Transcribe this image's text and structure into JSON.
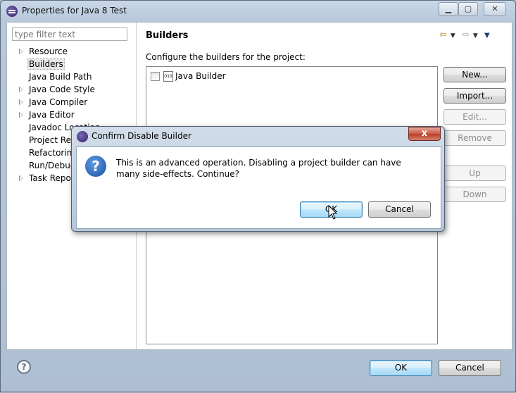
{
  "window": {
    "title": "Properties for Java 8 Test",
    "controls": [
      "minimize",
      "maximize",
      "close"
    ]
  },
  "sidebar": {
    "filter_placeholder": "type filter text",
    "items": [
      {
        "label": "Resource",
        "expandable": true
      },
      {
        "label": "Builders",
        "expandable": false,
        "selected": true
      },
      {
        "label": "Java Build Path",
        "expandable": false
      },
      {
        "label": "Java Code Style",
        "expandable": true
      },
      {
        "label": "Java Compiler",
        "expandable": true
      },
      {
        "label": "Java Editor",
        "expandable": true
      },
      {
        "label": "Javadoc Location",
        "expandable": false
      },
      {
        "label": "Project References",
        "expandable": false
      },
      {
        "label": "Refactoring History",
        "expandable": false
      },
      {
        "label": "Run/Debug Settings",
        "expandable": false
      },
      {
        "label": "Task Repository",
        "expandable": true
      }
    ]
  },
  "main": {
    "title": "Builders",
    "description": "Configure the builders for the project:",
    "builders": [
      {
        "label": "Java Builder",
        "checked": false
      }
    ],
    "buttons": {
      "new": "New...",
      "import": "Import...",
      "edit": "Edit...",
      "remove": "Remove",
      "up": "Up",
      "down": "Down"
    }
  },
  "footer": {
    "ok": "OK",
    "cancel": "Cancel"
  },
  "dialog": {
    "title": "Confirm Disable Builder",
    "close": "x",
    "message": "This is an advanced operation. Disabling a project builder can have many side-effects. Continue?",
    "ok": "OK",
    "cancel": "Cancel"
  }
}
